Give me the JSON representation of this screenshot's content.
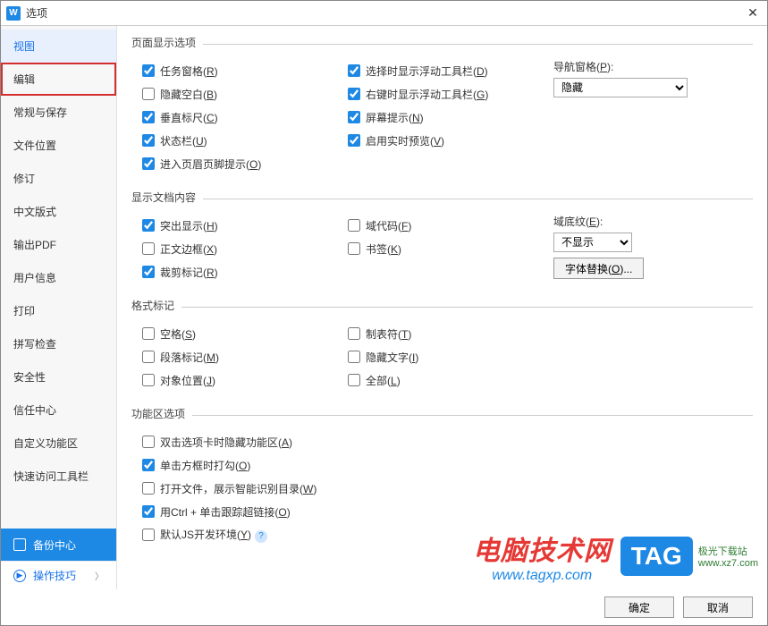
{
  "title": "选项",
  "sidebar": {
    "items": [
      {
        "label": "视图",
        "active": true
      },
      {
        "label": "编辑",
        "highlighted": true
      },
      {
        "label": "常规与保存"
      },
      {
        "label": "文件位置"
      },
      {
        "label": "修订"
      },
      {
        "label": "中文版式"
      },
      {
        "label": "输出PDF"
      },
      {
        "label": "用户信息"
      },
      {
        "label": "打印"
      },
      {
        "label": "拼写检查"
      },
      {
        "label": "安全性"
      },
      {
        "label": "信任中心"
      },
      {
        "label": "自定义功能区"
      },
      {
        "label": "快速访问工具栏"
      }
    ],
    "backup": "备份中心",
    "tips": "操作技巧"
  },
  "groups": {
    "display": {
      "legend": "页面显示选项",
      "col1": [
        {
          "label_pre": "任务窗格(",
          "key": "R",
          "label_post": ")",
          "checked": true
        },
        {
          "label_pre": "隐藏空白(",
          "key": "B",
          "label_post": ")",
          "checked": false
        },
        {
          "label_pre": "垂直标尺(",
          "key": "C",
          "label_post": ")",
          "checked": true
        },
        {
          "label_pre": "状态栏(",
          "key": "U",
          "label_post": ")",
          "checked": true
        },
        {
          "label_pre": "进入页眉页脚提示(",
          "key": "O",
          "label_post": ")",
          "checked": true
        }
      ],
      "col2": [
        {
          "label_pre": "选择时显示浮动工具栏(",
          "key": "D",
          "label_post": ")",
          "checked": true
        },
        {
          "label_pre": "右键时显示浮动工具栏(",
          "key": "G",
          "label_post": ")",
          "checked": true
        },
        {
          "label_pre": "屏幕提示(",
          "key": "N",
          "label_post": ")",
          "checked": true
        },
        {
          "label_pre": "启用实时预览(",
          "key": "V",
          "label_post": ")",
          "checked": true
        }
      ],
      "nav_label_pre": "导航窗格(",
      "nav_key": "P",
      "nav_label_post": "):",
      "nav_value": "隐藏"
    },
    "doc": {
      "legend": "显示文档内容",
      "col1": [
        {
          "label_pre": "突出显示(",
          "key": "H",
          "label_post": ")",
          "checked": true
        },
        {
          "label_pre": "正文边框(",
          "key": "X",
          "label_post": ")",
          "checked": false
        },
        {
          "label_pre": "裁剪标记(",
          "key": "R",
          "label_post": ")",
          "checked": true
        }
      ],
      "col2": [
        {
          "label_pre": "域代码(",
          "key": "F",
          "label_post": ")",
          "checked": false
        },
        {
          "label_pre": "书签(",
          "key": "K",
          "label_post": ")",
          "checked": false
        }
      ],
      "shade_label_pre": "域底纹(",
      "shade_key": "E",
      "shade_label_post": "):",
      "shade_value": "不显示",
      "font_sub_pre": "字体替换(",
      "font_sub_key": "O",
      "font_sub_post": ")..."
    },
    "marks": {
      "legend": "格式标记",
      "col1": [
        {
          "label_pre": "空格(",
          "key": "S",
          "label_post": ")",
          "checked": false
        },
        {
          "label_pre": "段落标记(",
          "key": "M",
          "label_post": ")",
          "checked": false
        },
        {
          "label_pre": "对象位置(",
          "key": "J",
          "label_post": ")",
          "checked": false
        }
      ],
      "col2": [
        {
          "label_pre": "制表符(",
          "key": "T",
          "label_post": ")",
          "checked": false
        },
        {
          "label_pre": "隐藏文字(",
          "key": "I",
          "label_post": ")",
          "checked": false
        },
        {
          "label_pre": "全部(",
          "key": "L",
          "label_post": ")",
          "checked": false
        }
      ]
    },
    "ribbon": {
      "legend": "功能区选项",
      "items": [
        {
          "label_pre": "双击选项卡时隐藏功能区(",
          "key": "A",
          "label_post": ")",
          "checked": false
        },
        {
          "label_pre": "单击方框时打勾(",
          "key": "O",
          "label_post": ")",
          "checked": true
        },
        {
          "label_pre": "打开文件，展示智能识别目录(",
          "key": "W",
          "label_post": ")",
          "checked": false
        },
        {
          "label_pre": "用Ctrl + 单击跟踪超链接(",
          "key": "O",
          "label_post": ")",
          "checked": true
        },
        {
          "label_pre": "默认JS开发环境(",
          "key": "Y",
          "label_post": ")",
          "checked": false,
          "help": true
        }
      ]
    }
  },
  "footer": {
    "ok": "确定",
    "cancel": "取消"
  },
  "watermark": {
    "a_line1": "电脑技术网",
    "a_line2": "www.tagxp.com",
    "b_tag": "TAG",
    "b_site1": "极光下载站",
    "b_site2": "www.xz7.com"
  }
}
